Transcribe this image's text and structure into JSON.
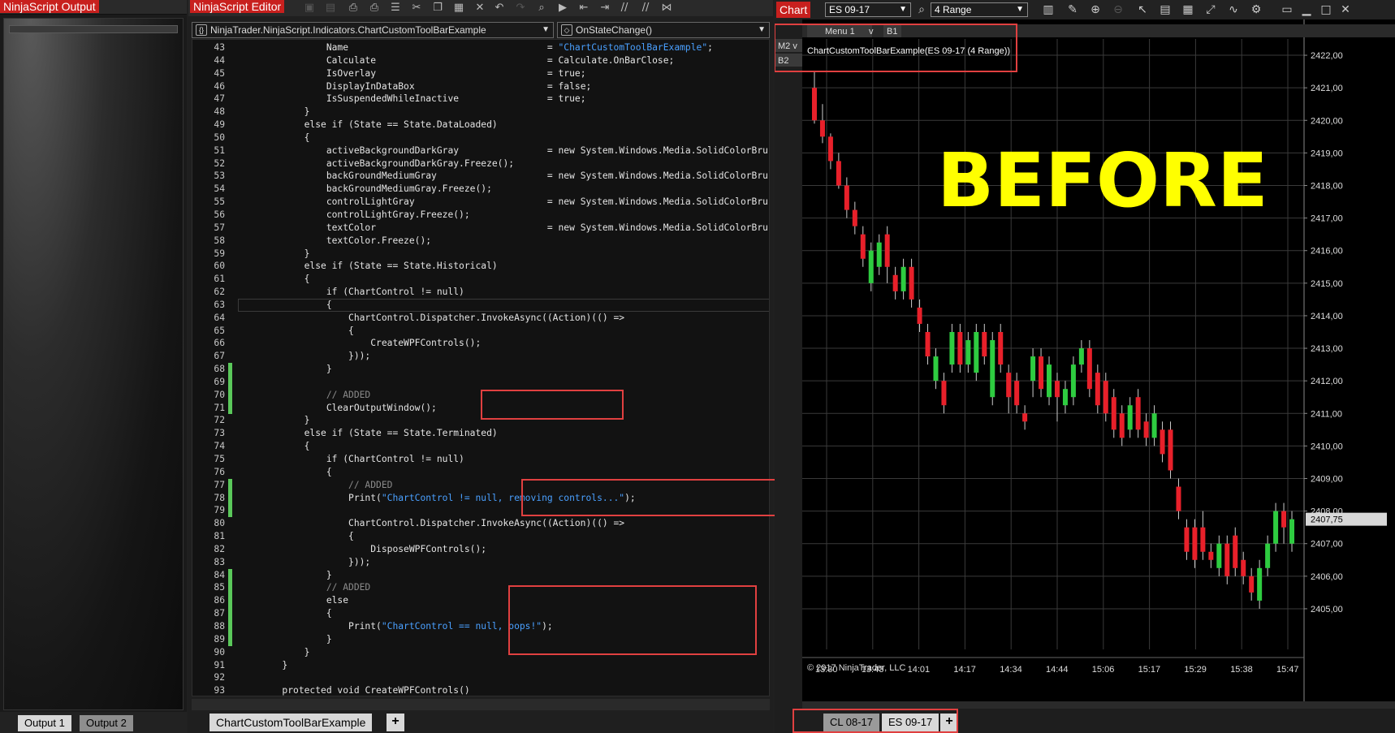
{
  "output": {
    "title": "NinjaScript Output",
    "tabs": [
      {
        "label": "Output 1"
      },
      {
        "label": "Output 2"
      }
    ]
  },
  "editor": {
    "title": "NinjaScript Editor",
    "class_dropdown": "NinjaTrader.NinjaScript.Indicators.ChartCustomToolBarExample",
    "method_dropdown": "OnStateChange()",
    "tab": "ChartCustomToolBarExample",
    "add_tab": "+",
    "lines": [
      {
        "n": "43",
        "indent": 4,
        "t": "Name",
        "pad": "                                    = ",
        "s": "\"ChartCustomToolBarExample\"",
        "e": ";",
        "chg": false
      },
      {
        "n": "44",
        "indent": 4,
        "t": "Calculate",
        "pad": "                               = ",
        "s": "",
        "e": "Calculate.OnBarClose;",
        "chg": false
      },
      {
        "n": "45",
        "indent": 4,
        "t": "IsOverlay",
        "pad": "                               = ",
        "s": "",
        "e": "true;",
        "chg": false
      },
      {
        "n": "46",
        "indent": 4,
        "t": "DisplayInDataBox",
        "pad": "                        = ",
        "s": "",
        "e": "false;",
        "chg": false
      },
      {
        "n": "47",
        "indent": 4,
        "t": "IsSuspendedWhileInactive",
        "pad": "                = ",
        "s": "",
        "e": "true;",
        "chg": false
      },
      {
        "n": "48",
        "indent": 3,
        "t": "}",
        "pad": "",
        "s": "",
        "e": "",
        "chg": false
      },
      {
        "n": "49",
        "indent": 3,
        "t": "else if (State == State.DataLoaded)",
        "pad": "",
        "s": "",
        "e": "",
        "chg": false
      },
      {
        "n": "50",
        "indent": 3,
        "t": "{",
        "pad": "",
        "s": "",
        "e": "",
        "chg": false
      },
      {
        "n": "51",
        "indent": 4,
        "t": "activeBackgroundDarkGray",
        "pad": "                = ",
        "s": "",
        "e": "new System.Windows.Media.SolidColorBrus",
        "chg": false
      },
      {
        "n": "52",
        "indent": 4,
        "t": "activeBackgroundDarkGray.Freeze();",
        "pad": "",
        "s": "",
        "e": "",
        "chg": false
      },
      {
        "n": "53",
        "indent": 4,
        "t": "backGroundMediumGray",
        "pad": "                    = ",
        "s": "",
        "e": "new System.Windows.Media.SolidColorBrus",
        "chg": false
      },
      {
        "n": "54",
        "indent": 4,
        "t": "backGroundMediumGray.Freeze();",
        "pad": "",
        "s": "",
        "e": "",
        "chg": false
      },
      {
        "n": "55",
        "indent": 4,
        "t": "controlLightGray",
        "pad": "                        = ",
        "s": "",
        "e": "new System.Windows.Media.SolidColorBrus",
        "chg": false
      },
      {
        "n": "56",
        "indent": 4,
        "t": "controlLightGray.Freeze();",
        "pad": "",
        "s": "",
        "e": "",
        "chg": false
      },
      {
        "n": "57",
        "indent": 4,
        "t": "textColor",
        "pad": "                               = ",
        "s": "",
        "e": "new System.Windows.Media.SolidColorBrus",
        "chg": false
      },
      {
        "n": "58",
        "indent": 4,
        "t": "textColor.Freeze();",
        "pad": "",
        "s": "",
        "e": "",
        "chg": false
      },
      {
        "n": "59",
        "indent": 3,
        "t": "}",
        "pad": "",
        "s": "",
        "e": "",
        "chg": false
      },
      {
        "n": "60",
        "indent": 3,
        "t": "else if (State == State.Historical)",
        "pad": "",
        "s": "",
        "e": "",
        "chg": false
      },
      {
        "n": "61",
        "indent": 3,
        "t": "{",
        "pad": "",
        "s": "",
        "e": "",
        "chg": false
      },
      {
        "n": "62",
        "indent": 4,
        "t": "if (ChartControl != null)",
        "pad": "",
        "s": "",
        "e": "",
        "chg": false
      },
      {
        "n": "63",
        "indent": 4,
        "t": "{",
        "pad": "",
        "s": "",
        "e": "",
        "chg": false
      },
      {
        "n": "64",
        "indent": 5,
        "t": "ChartControl.Dispatcher.InvokeAsync((Action)(() =>",
        "pad": "",
        "s": "",
        "e": "",
        "chg": false
      },
      {
        "n": "65",
        "indent": 5,
        "t": "{",
        "pad": "",
        "s": "",
        "e": "",
        "chg": false
      },
      {
        "n": "66",
        "indent": 6,
        "t": "CreateWPFControls();",
        "pad": "",
        "s": "",
        "e": "",
        "chg": false
      },
      {
        "n": "67",
        "indent": 5,
        "t": "}));",
        "pad": "",
        "s": "",
        "e": "",
        "chg": false
      },
      {
        "n": "68",
        "indent": 4,
        "t": "}",
        "pad": "",
        "s": "",
        "e": "",
        "chg": true
      },
      {
        "n": "69",
        "indent": 0,
        "t": "",
        "pad": "",
        "s": "",
        "e": "",
        "chg": true
      },
      {
        "n": "70",
        "indent": 4,
        "t": "",
        "pad": "",
        "s": "",
        "e": "",
        "c": "// ADDED",
        "chg": true
      },
      {
        "n": "71",
        "indent": 4,
        "t": "ClearOutputWindow();",
        "pad": "",
        "s": "",
        "e": "",
        "chg": true
      },
      {
        "n": "72",
        "indent": 3,
        "t": "}",
        "pad": "",
        "s": "",
        "e": "",
        "chg": false
      },
      {
        "n": "73",
        "indent": 3,
        "t": "else if (State == State.Terminated)",
        "pad": "",
        "s": "",
        "e": "",
        "chg": false
      },
      {
        "n": "74",
        "indent": 3,
        "t": "{",
        "pad": "",
        "s": "",
        "e": "",
        "chg": false
      },
      {
        "n": "75",
        "indent": 4,
        "t": "if (ChartControl != null)",
        "pad": "",
        "s": "",
        "e": "",
        "chg": false
      },
      {
        "n": "76",
        "indent": 4,
        "t": "{",
        "pad": "",
        "s": "",
        "e": "",
        "chg": false
      },
      {
        "n": "77",
        "indent": 5,
        "t": "",
        "pad": "",
        "s": "",
        "e": "",
        "c": "// ADDED",
        "chg": true
      },
      {
        "n": "78",
        "indent": 5,
        "t": "Print(",
        "pad": "",
        "s": "\"ChartControl != null, removing controls...\"",
        "e": ");",
        "chg": true
      },
      {
        "n": "79",
        "indent": 0,
        "t": "",
        "pad": "",
        "s": "",
        "e": "",
        "chg": true
      },
      {
        "n": "80",
        "indent": 5,
        "t": "ChartControl.Dispatcher.InvokeAsync((Action)(() =>",
        "pad": "",
        "s": "",
        "e": "",
        "chg": false
      },
      {
        "n": "81",
        "indent": 5,
        "t": "{",
        "pad": "",
        "s": "",
        "e": "",
        "chg": false
      },
      {
        "n": "82",
        "indent": 6,
        "t": "DisposeWPFControls();",
        "pad": "",
        "s": "",
        "e": "",
        "chg": false
      },
      {
        "n": "83",
        "indent": 5,
        "t": "}));",
        "pad": "",
        "s": "",
        "e": "",
        "chg": false
      },
      {
        "n": "84",
        "indent": 4,
        "t": "}",
        "pad": "",
        "s": "",
        "e": "",
        "chg": true
      },
      {
        "n": "85",
        "indent": 4,
        "t": "",
        "pad": "",
        "s": "",
        "e": "",
        "c": "// ADDED",
        "chg": true
      },
      {
        "n": "86",
        "indent": 4,
        "t": "else",
        "pad": "",
        "s": "",
        "e": "",
        "chg": true
      },
      {
        "n": "87",
        "indent": 4,
        "t": "{",
        "pad": "",
        "s": "",
        "e": "",
        "chg": true
      },
      {
        "n": "88",
        "indent": 5,
        "t": "Print(",
        "pad": "",
        "s": "\"ChartControl == null, oops!\"",
        "e": ");",
        "chg": true
      },
      {
        "n": "89",
        "indent": 4,
        "t": "}",
        "pad": "",
        "s": "",
        "e": "",
        "chg": true
      },
      {
        "n": "90",
        "indent": 3,
        "t": "}",
        "pad": "",
        "s": "",
        "e": "",
        "chg": false
      },
      {
        "n": "91",
        "indent": 2,
        "t": "}",
        "pad": "",
        "s": "",
        "e": "",
        "chg": false
      },
      {
        "n": "92",
        "indent": 0,
        "t": "",
        "pad": "",
        "s": "",
        "e": "",
        "chg": false
      },
      {
        "n": "93",
        "indent": 2,
        "t": "protected void CreateWPFControls()",
        "pad": "",
        "s": "",
        "e": "",
        "chg": false
      }
    ]
  },
  "chart": {
    "title": "Chart",
    "instrument": "ES 09-17",
    "bar_type": "4 Range",
    "menu1": "Menu 1",
    "menu_v": "v",
    "b1": "B1",
    "m2": "M2 v",
    "b2": "B2",
    "indicator_label": "ChartCustomToolBarExample(ES 09-17 (4 Range))",
    "overlay_text": "BEFORE",
    "copyright": "© 2017 NinjaTrader, LLC",
    "tabs": [
      {
        "label": "CL 08-17"
      },
      {
        "label": "ES 09-17"
      }
    ],
    "add_tab": "+",
    "colors": {
      "up": "#2ecc40",
      "down": "#e8202a",
      "overlay": "#ffff00",
      "price_box": "#d8d8d8"
    }
  },
  "chart_data": {
    "type": "candlestick",
    "ylim": [
      2404.5,
      2422.5
    ],
    "y_ticks": [
      "2422,00",
      "2421,00",
      "2420,00",
      "2419,00",
      "2418,00",
      "2417,00",
      "2416,00",
      "2415,00",
      "2414,00",
      "2413,00",
      "2412,00",
      "2411,00",
      "2410,00",
      "2409,00",
      "2408,00",
      "2407,00",
      "2406,00",
      "2405,00"
    ],
    "y_tick_values": [
      2422,
      2421,
      2420,
      2419,
      2418,
      2417,
      2416,
      2415,
      2414,
      2413,
      2412,
      2411,
      2410,
      2409,
      2408,
      2407,
      2406,
      2405
    ],
    "x_ticks": [
      "13:30",
      "13:43",
      "14:01",
      "14:17",
      "14:34",
      "14:44",
      "15:06",
      "15:17",
      "15:29",
      "15:38",
      "15:47"
    ],
    "last_price": "2407,75",
    "last_value": 2407.75,
    "candles": [
      {
        "o": 2421.0,
        "c": 2420.0,
        "h": 2421.5,
        "l": 2419.9
      },
      {
        "o": 2420.0,
        "c": 2419.5,
        "h": 2420.5,
        "l": 2419.3
      },
      {
        "o": 2419.5,
        "c": 2418.75,
        "h": 2419.6,
        "l": 2418.5
      },
      {
        "o": 2418.75,
        "c": 2418.0,
        "h": 2419.0,
        "l": 2417.9
      },
      {
        "o": 2418.0,
        "c": 2417.25,
        "h": 2418.25,
        "l": 2417.0
      },
      {
        "o": 2417.25,
        "c": 2416.75,
        "h": 2417.5,
        "l": 2416.5
      },
      {
        "o": 2416.5,
        "c": 2415.75,
        "h": 2416.75,
        "l": 2415.5
      },
      {
        "o": 2415.0,
        "c": 2416.0,
        "h": 2416.25,
        "l": 2414.75
      },
      {
        "o": 2415.5,
        "c": 2416.25,
        "h": 2416.5,
        "l": 2415.25
      },
      {
        "o": 2416.5,
        "c": 2415.5,
        "h": 2416.75,
        "l": 2415.0
      },
      {
        "o": 2415.25,
        "c": 2414.75,
        "h": 2415.5,
        "l": 2414.5
      },
      {
        "o": 2414.75,
        "c": 2415.5,
        "h": 2415.75,
        "l": 2414.5
      },
      {
        "o": 2415.5,
        "c": 2414.5,
        "h": 2415.75,
        "l": 2414.25
      },
      {
        "o": 2414.25,
        "c": 2413.75,
        "h": 2414.5,
        "l": 2413.5
      },
      {
        "o": 2413.5,
        "c": 2412.75,
        "h": 2413.75,
        "l": 2412.5
      },
      {
        "o": 2412.0,
        "c": 2412.75,
        "h": 2413.0,
        "l": 2411.75
      },
      {
        "o": 2412.0,
        "c": 2411.25,
        "h": 2412.25,
        "l": 2411.0
      },
      {
        "o": 2412.5,
        "c": 2413.5,
        "h": 2413.75,
        "l": 2412.25
      },
      {
        "o": 2413.5,
        "c": 2412.5,
        "h": 2413.75,
        "l": 2412.25
      },
      {
        "o": 2412.5,
        "c": 2413.25,
        "h": 2413.5,
        "l": 2412.25
      },
      {
        "o": 2412.25,
        "c": 2413.5,
        "h": 2413.75,
        "l": 2412.0
      },
      {
        "o": 2413.5,
        "c": 2412.75,
        "h": 2413.75,
        "l": 2412.5
      },
      {
        "o": 2411.5,
        "c": 2413.25,
        "h": 2413.5,
        "l": 2411.25
      },
      {
        "o": 2413.5,
        "c": 2412.5,
        "h": 2413.75,
        "l": 2412.25
      },
      {
        "o": 2412.25,
        "c": 2411.5,
        "h": 2412.5,
        "l": 2411.0
      },
      {
        "o": 2412.0,
        "c": 2411.25,
        "h": 2412.25,
        "l": 2411.0
      },
      {
        "o": 2411.0,
        "c": 2410.75,
        "h": 2411.25,
        "l": 2410.5
      },
      {
        "o": 2412.0,
        "c": 2412.75,
        "h": 2413.0,
        "l": 2411.5
      },
      {
        "o": 2412.75,
        "c": 2411.75,
        "h": 2413.0,
        "l": 2411.5
      },
      {
        "o": 2411.5,
        "c": 2412.5,
        "h": 2412.75,
        "l": 2411.25
      },
      {
        "o": 2412.0,
        "c": 2411.5,
        "h": 2412.25,
        "l": 2410.75
      },
      {
        "o": 2411.25,
        "c": 2411.75,
        "h": 2412.0,
        "l": 2411.0
      },
      {
        "o": 2411.5,
        "c": 2412.5,
        "h": 2412.75,
        "l": 2411.25
      },
      {
        "o": 2412.5,
        "c": 2413.0,
        "h": 2413.25,
        "l": 2412.25
      },
      {
        "o": 2413.0,
        "c": 2411.75,
        "h": 2413.25,
        "l": 2411.5
      },
      {
        "o": 2412.25,
        "c": 2411.25,
        "h": 2412.5,
        "l": 2411.0
      },
      {
        "o": 2412.0,
        "c": 2411.0,
        "h": 2412.25,
        "l": 2410.75
      },
      {
        "o": 2411.5,
        "c": 2410.5,
        "h": 2411.75,
        "l": 2410.25
      },
      {
        "o": 2411.0,
        "c": 2410.25,
        "h": 2411.25,
        "l": 2410.0
      },
      {
        "o": 2410.5,
        "c": 2411.25,
        "h": 2411.5,
        "l": 2410.25
      },
      {
        "o": 2411.5,
        "c": 2410.5,
        "h": 2411.75,
        "l": 2410.25
      },
      {
        "o": 2410.75,
        "c": 2410.25,
        "h": 2411.0,
        "l": 2410.0
      },
      {
        "o": 2410.25,
        "c": 2411.0,
        "h": 2411.25,
        "l": 2410.0
      },
      {
        "o": 2410.5,
        "c": 2409.75,
        "h": 2410.75,
        "l": 2409.5
      },
      {
        "o": 2410.5,
        "c": 2409.25,
        "h": 2410.75,
        "l": 2409.0
      },
      {
        "o": 2408.75,
        "c": 2408.0,
        "h": 2409.0,
        "l": 2407.75
      },
      {
        "o": 2407.5,
        "c": 2406.75,
        "h": 2407.75,
        "l": 2406.5
      },
      {
        "o": 2407.5,
        "c": 2406.5,
        "h": 2407.75,
        "l": 2406.25
      },
      {
        "o": 2407.5,
        "c": 2406.75,
        "h": 2408.0,
        "l": 2406.5
      },
      {
        "o": 2406.75,
        "c": 2406.5,
        "h": 2407.0,
        "l": 2406.25
      },
      {
        "o": 2406.25,
        "c": 2407.0,
        "h": 2407.25,
        "l": 2406.0
      },
      {
        "o": 2407.0,
        "c": 2406.0,
        "h": 2407.25,
        "l": 2405.75
      },
      {
        "o": 2407.25,
        "c": 2406.25,
        "h": 2407.5,
        "l": 2406.0
      },
      {
        "o": 2406.5,
        "c": 2406.0,
        "h": 2406.75,
        "l": 2405.75
      },
      {
        "o": 2406.0,
        "c": 2405.5,
        "h": 2406.25,
        "l": 2405.25
      },
      {
        "o": 2405.25,
        "c": 2406.25,
        "h": 2406.5,
        "l": 2405.0
      },
      {
        "o": 2406.25,
        "c": 2407.0,
        "h": 2407.25,
        "l": 2406.0
      },
      {
        "o": 2407.0,
        "c": 2408.0,
        "h": 2408.25,
        "l": 2406.75
      },
      {
        "o": 2408.0,
        "c": 2407.5,
        "h": 2408.25,
        "l": 2407.0
      },
      {
        "o": 2407.0,
        "c": 2407.75,
        "h": 2408.0,
        "l": 2406.75
      }
    ]
  }
}
